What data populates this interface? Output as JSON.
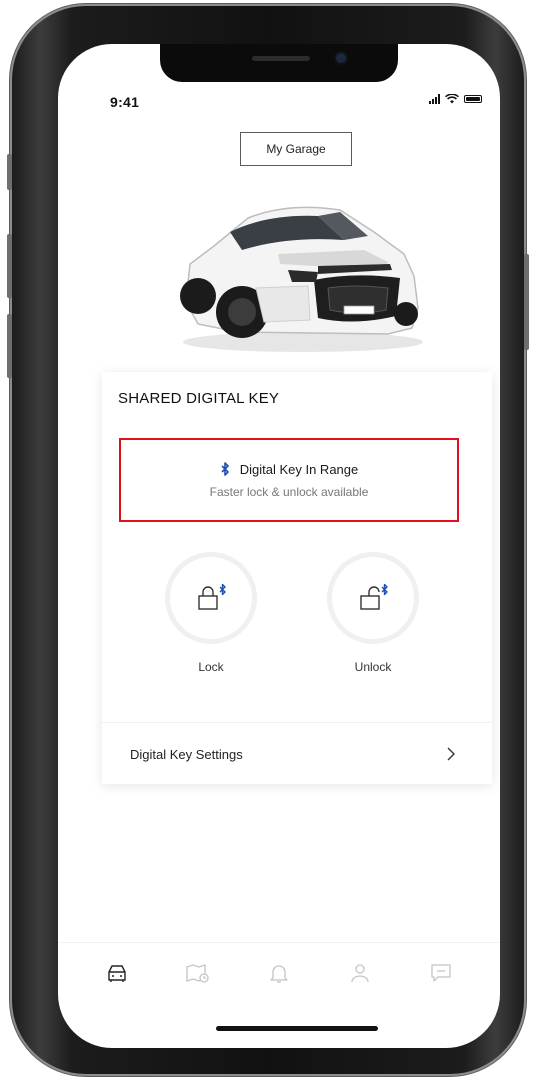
{
  "status_bar": {
    "time": "9:41"
  },
  "header": {
    "garage_button_label": "My Garage"
  },
  "vehicle": {
    "plate_text": "",
    "color": "#f4f4f4"
  },
  "digital_key": {
    "title": "SHARED DIGITAL KEY",
    "range_status": "Digital Key In Range",
    "range_substatus": "Faster lock & unlock available",
    "actions": [
      {
        "label": "Lock",
        "icon": "lock-bluetooth-icon"
      },
      {
        "label": "Unlock",
        "icon": "unlock-bluetooth-icon"
      }
    ],
    "settings_label": "Digital Key Settings"
  },
  "tab_bar": {
    "tabs": [
      {
        "icon": "car-icon",
        "active": true
      },
      {
        "icon": "map-icon",
        "active": false
      },
      {
        "icon": "bell-icon",
        "active": false
      },
      {
        "icon": "profile-icon",
        "active": false
      },
      {
        "icon": "chat-icon",
        "active": false
      }
    ]
  },
  "colors": {
    "highlight_border": "#e0101d",
    "bluetooth_accent": "#1e4fae",
    "active_icon": "#222222",
    "inactive_icon": "#c4c4c4"
  }
}
